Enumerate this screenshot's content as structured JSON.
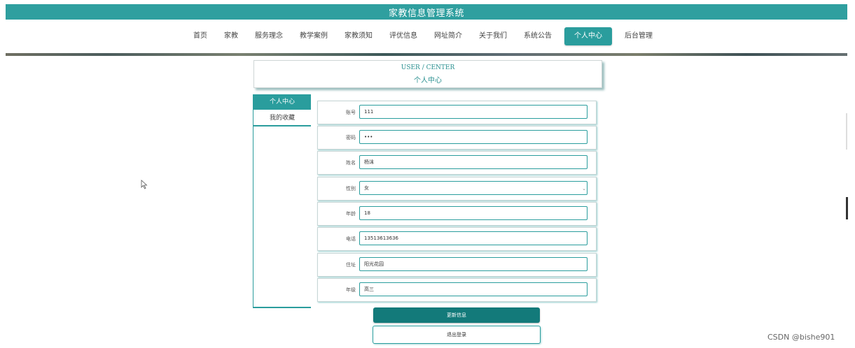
{
  "site": {
    "title": "家教信息管理系统"
  },
  "nav": {
    "items": [
      {
        "label": "首页",
        "active": false
      },
      {
        "label": "家教",
        "active": false
      },
      {
        "label": "服务理念",
        "active": false
      },
      {
        "label": "教学案例",
        "active": false
      },
      {
        "label": "家教须知",
        "active": false
      },
      {
        "label": "评优信息",
        "active": false
      },
      {
        "label": "网址简介",
        "active": false
      },
      {
        "label": "关于我们",
        "active": false
      },
      {
        "label": "系统公告",
        "active": false
      },
      {
        "label": "个人中心",
        "active": true
      },
      {
        "label": "后台管理",
        "active": false
      }
    ]
  },
  "page_title": {
    "en": "USER / CENTER",
    "zh": "个人中心"
  },
  "sidebar": {
    "items": [
      {
        "label": "个人中心",
        "active": true
      },
      {
        "label": "我的收藏",
        "active": false
      }
    ]
  },
  "form": {
    "fields": [
      {
        "label": "账号",
        "value": "111",
        "type": "text"
      },
      {
        "label": "密码",
        "value": "•••",
        "type": "password"
      },
      {
        "label": "姓名",
        "value": "杨沫",
        "type": "text"
      },
      {
        "label": "性别",
        "value": "女",
        "type": "select"
      },
      {
        "label": "年龄",
        "value": "18",
        "type": "text"
      },
      {
        "label": "电话",
        "value": "13513613636",
        "type": "text"
      },
      {
        "label": "住址",
        "value": "阳光花园",
        "type": "text"
      },
      {
        "label": "年级",
        "value": "高三",
        "type": "text"
      }
    ]
  },
  "buttons": {
    "update": "更新信息",
    "logout": "退出登录"
  },
  "watermark": "CSDN @bishe901",
  "colors": {
    "accent": "#2a9d9d",
    "accent_dark": "#137a7a",
    "header": "#2f9f9f"
  },
  "icons": {
    "select_chevron": "chevron-down-icon",
    "cursor": "mouse-pointer-icon"
  }
}
